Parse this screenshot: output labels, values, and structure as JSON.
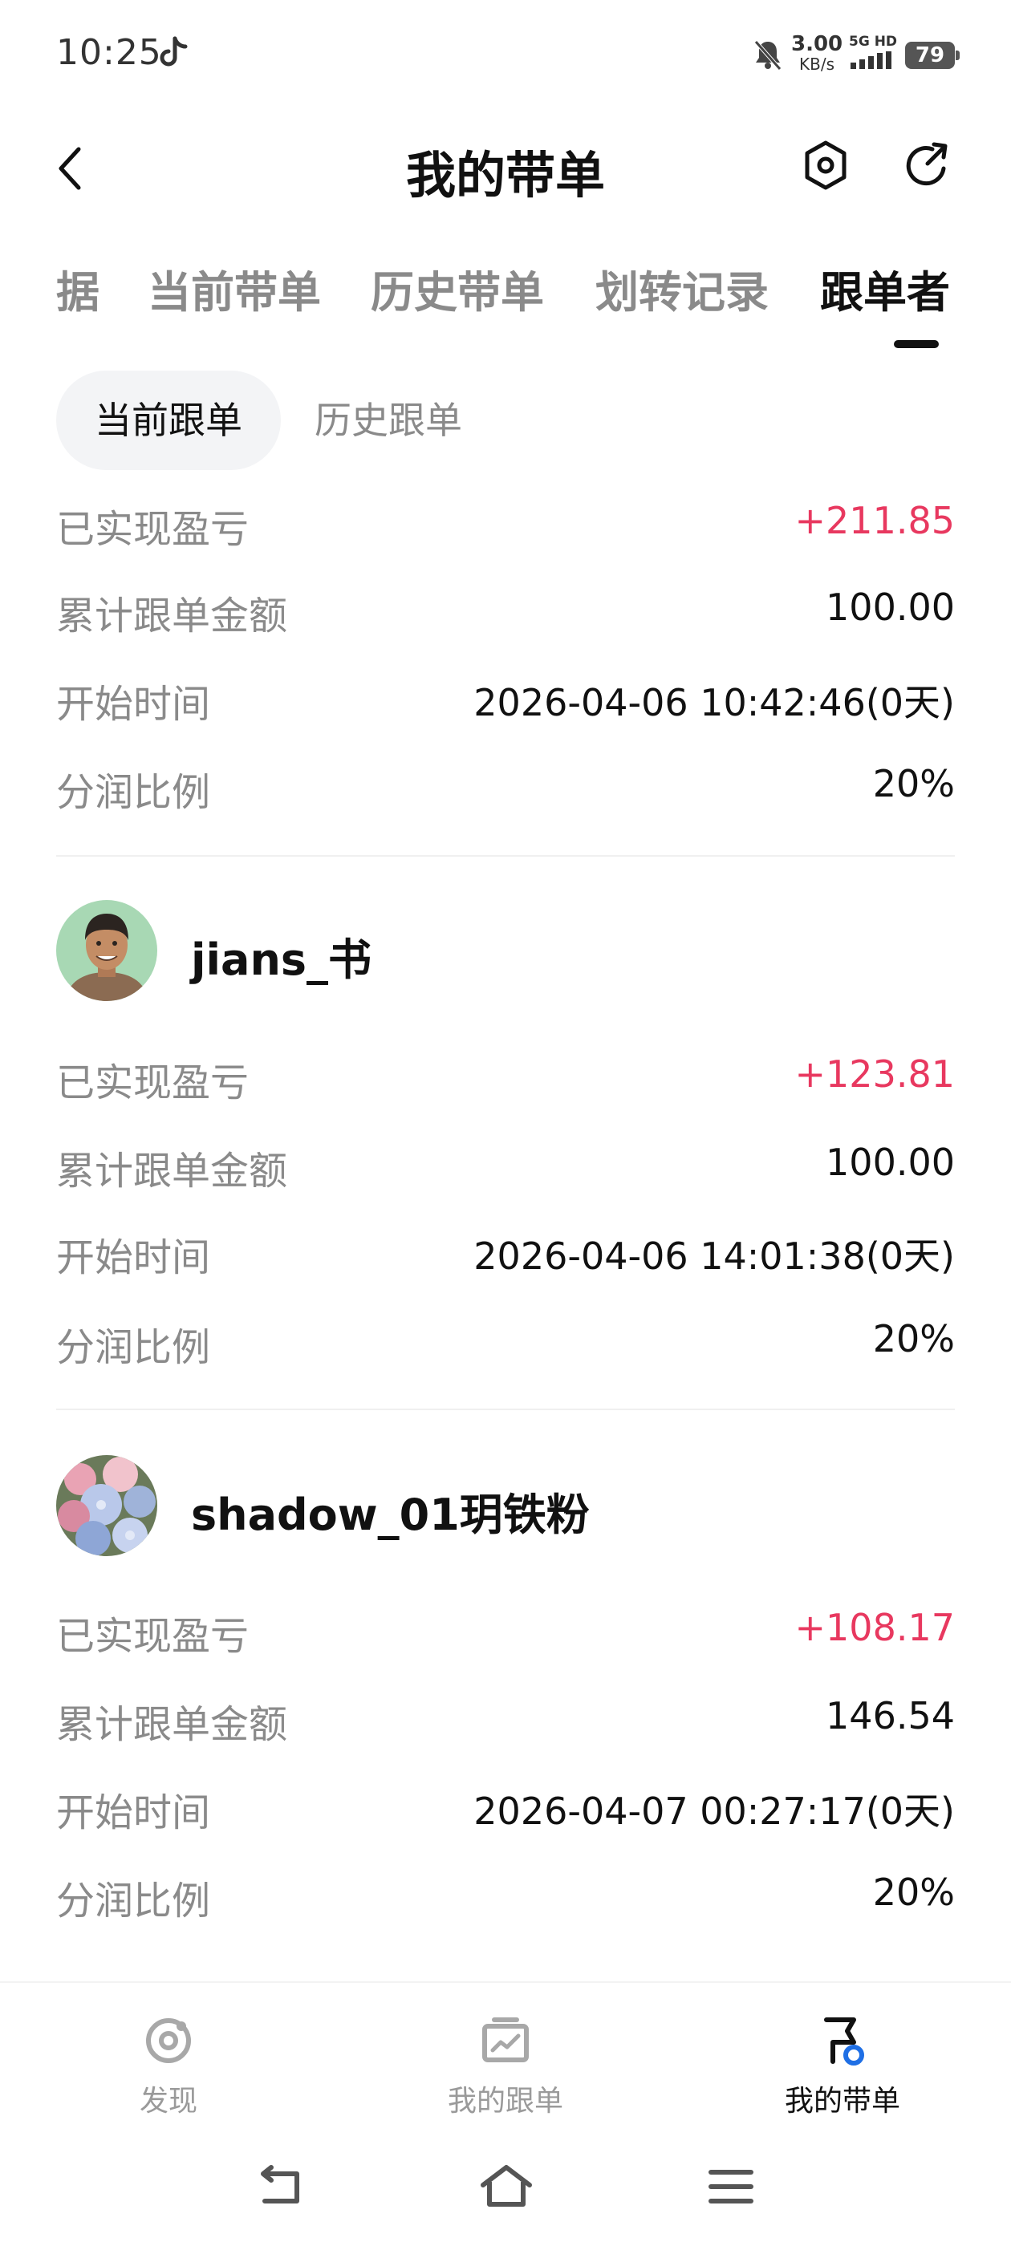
{
  "status_bar": {
    "time": "10:25",
    "net_speed_value": "3.00",
    "net_speed_unit": "KB/s",
    "signal_label": "5G HD",
    "battery": "79"
  },
  "header": {
    "title": "我的带单"
  },
  "tabs": [
    {
      "label": "据",
      "active": false
    },
    {
      "label": "当前带单",
      "active": false
    },
    {
      "label": "历史带单",
      "active": false
    },
    {
      "label": "划转记录",
      "active": false
    },
    {
      "label": "跟单者",
      "active": true
    }
  ],
  "subtabs": [
    {
      "label": "当前跟单",
      "active": true
    },
    {
      "label": "历史跟单",
      "active": false
    }
  ],
  "records": [
    {
      "name": "",
      "rows": [
        {
          "label": "已实现盈亏",
          "value": "+211.85"
        },
        {
          "label": "累计跟单金额",
          "value": "100.00"
        },
        {
          "label": "开始时间",
          "value": "2026-04-06 10:42:46(0天)"
        },
        {
          "label": "分润比例",
          "value": "20%"
        }
      ]
    },
    {
      "name": "jians_书",
      "rows": [
        {
          "label": "已实现盈亏",
          "value": "+123.81"
        },
        {
          "label": "累计跟单金额",
          "value": "100.00"
        },
        {
          "label": "开始时间",
          "value": "2026-04-06 14:01:38(0天)"
        },
        {
          "label": "分润比例",
          "value": "20%"
        }
      ]
    },
    {
      "name": "shadow_01玥铁粉",
      "rows": [
        {
          "label": "已实现盈亏",
          "value": "+108.17"
        },
        {
          "label": "累计跟单金额",
          "value": "146.54"
        },
        {
          "label": "开始时间",
          "value": "2026-04-07 00:27:17(0天)"
        },
        {
          "label": "分润比例",
          "value": "20%"
        }
      ]
    }
  ],
  "bottom_nav": [
    {
      "label": "发现",
      "icon": "discover-icon",
      "active": false
    },
    {
      "label": "我的跟单",
      "icon": "chart-board-icon",
      "active": false
    },
    {
      "label": "我的带单",
      "icon": "flag-icon",
      "active": true
    }
  ],
  "colors": {
    "profit": "#e8385f",
    "label_gray": "#8a8a8a",
    "text": "#111111",
    "accent_blue": "#1f6fe5"
  }
}
